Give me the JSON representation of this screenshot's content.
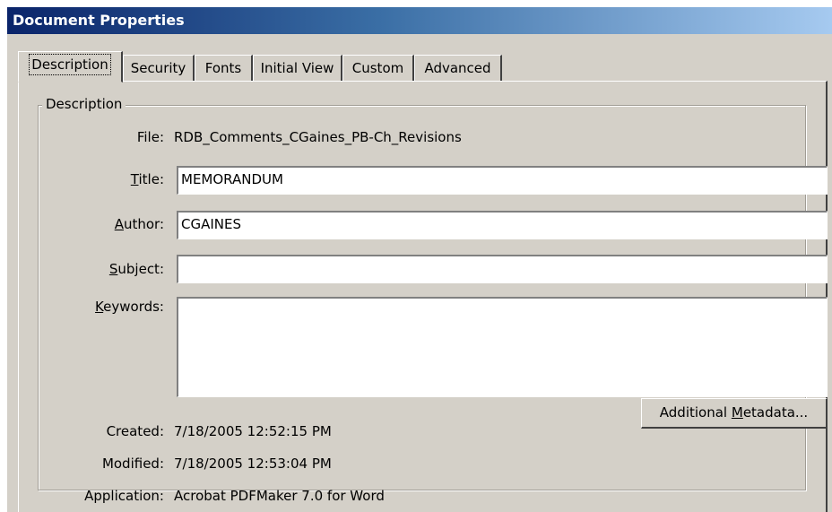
{
  "window": {
    "title": "Document Properties"
  },
  "tabs": [
    {
      "label": "Description",
      "active": true
    },
    {
      "label": "Security"
    },
    {
      "label": "Fonts"
    },
    {
      "label": "Initial View"
    },
    {
      "label": "Custom"
    },
    {
      "label": "Advanced"
    }
  ],
  "description": {
    "group_label": "Description",
    "file": {
      "label": "File:",
      "value": "RDB_Comments_CGaines_PB-Ch_Revisions"
    },
    "title": {
      "label_mnemonic": "T",
      "label_rest": "itle:",
      "value": "MEMORANDUM"
    },
    "author": {
      "label_mnemonic": "A",
      "label_rest": "uthor:",
      "value": "CGAINES"
    },
    "subject": {
      "label_mnemonic": "S",
      "label_rest": "ubject:",
      "value": ""
    },
    "keywords": {
      "label_mnemonic": "K",
      "label_rest": "eywords:",
      "value": ""
    },
    "created": {
      "label": "Created:",
      "value": "7/18/2005 12:52:15 PM"
    },
    "modified": {
      "label": "Modified:",
      "value": "7/18/2005 12:53:04 PM"
    },
    "application": {
      "label": "Application:",
      "value": "Acrobat PDFMaker 7.0 for Word"
    },
    "metadata_button": {
      "pre": "Additional ",
      "mnemonic": "M",
      "post": "etadata..."
    }
  }
}
